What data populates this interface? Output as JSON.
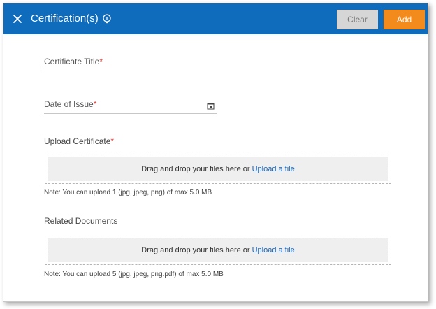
{
  "header": {
    "title": "Certification(s)",
    "clear_label": "Clear",
    "add_label": "Add",
    "colors": {
      "bar": "#0f6cbd",
      "add": "#f28a1c",
      "clear": "#d6d6d6"
    }
  },
  "form": {
    "certificate_title": {
      "label": "Certificate Title",
      "required_mark": "*",
      "value": ""
    },
    "date_of_issue": {
      "label": "Date of Issue",
      "required_mark": "*",
      "value": "",
      "icon": "calendar-icon"
    },
    "upload_certificate": {
      "label": "Upload Certificate",
      "required_mark": "*",
      "drop_text": "Drag and drop your files here or",
      "link_text": "Upload a file",
      "note": "Note: You can upload 1 (jpg, jpeg, png) of max 5.0 MB"
    },
    "related_documents": {
      "label": "Related Documents",
      "drop_text": "Drag and drop your files here or",
      "link_text": "Upload a file",
      "note": "Note: You can upload 5 (jpg, jpeg, png.pdf) of max 5.0 MB"
    }
  }
}
